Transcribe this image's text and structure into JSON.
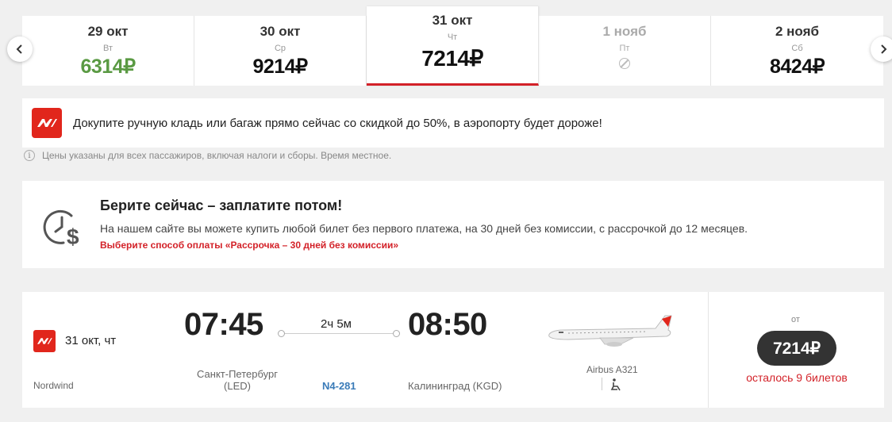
{
  "date_bar": {
    "days": [
      {
        "date": "29 окт",
        "weekday": "Вт",
        "price": "6314₽",
        "state": "cheapest"
      },
      {
        "date": "30 окт",
        "weekday": "Ср",
        "price": "9214₽",
        "state": "normal"
      },
      {
        "date": "31 окт",
        "weekday": "Чт",
        "price": "7214₽",
        "state": "selected"
      },
      {
        "date": "1 нояб",
        "weekday": "Пт",
        "price": "",
        "state": "unavailable"
      },
      {
        "date": "2 нояб",
        "weekday": "Сб",
        "price": "8424₽",
        "state": "normal"
      }
    ],
    "prev_icon": "chevron-left-icon",
    "next_icon": "chevron-right-icon"
  },
  "promo": {
    "text": "Докупите ручную кладь или багаж прямо сейчас со скидкой до 50%, в аэропорту будет дороже!",
    "logo": "nordwind-logo"
  },
  "note": {
    "icon": "info-icon",
    "text": "Цены указаны для всех пассажиров, включая налоги и сборы. Время местное."
  },
  "installment": {
    "icon": "clock-dollar-icon",
    "title": "Берите сейчас – заплатите потом!",
    "description": "На нашем сайте вы можете купить любой билет без первого платежа, на 30 дней без комиссии, с рассрочкой до 12 месяцев.",
    "link": "Выберите способ оплаты «Рассрочка – 30 дней без комиссии»"
  },
  "flight": {
    "date": "31 окт, чт",
    "airline": "Nordwind",
    "departure_time": "07:45",
    "arrival_time": "08:50",
    "duration": "2ч 5м",
    "departure_city": "Санкт-Петербург",
    "departure_code": "(LED)",
    "flight_number": "N4-281",
    "arrival_city": "Калининград (KGD)",
    "aircraft": "Airbus A321",
    "price_prefix": "от",
    "price": "7214₽",
    "seats_left": "осталось 9 билетов"
  },
  "colors": {
    "brand_red": "#e1261c",
    "cheap_green": "#5a9a43",
    "price_button": "#333333",
    "link_blue": "#3a7bb8"
  }
}
